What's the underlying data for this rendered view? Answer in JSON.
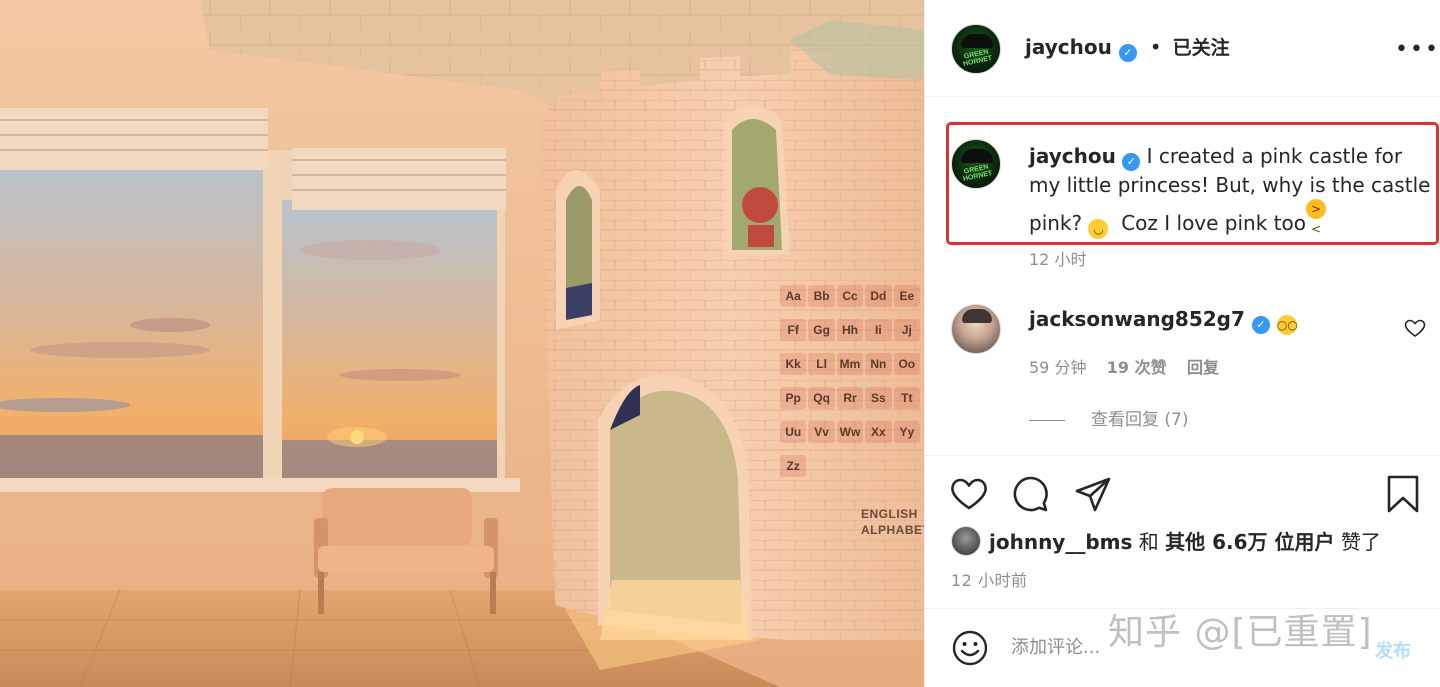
{
  "photo": {
    "alphabet_tiles": [
      "Aa",
      "Bb",
      "Cc",
      "Dd",
      "Ee",
      "Ff",
      "Gg",
      "Hh",
      "Ii",
      "Jj",
      "Kk",
      "Ll",
      "Mm",
      "Nn",
      "Oo",
      "Pp",
      "Qq",
      "Rr",
      "Ss",
      "Tt",
      "Uu",
      "Vv",
      "Ww",
      "Xx",
      "Yy",
      "Zz"
    ],
    "caption": "ENGLISH\nALPHABET"
  },
  "header": {
    "username": "jaychou",
    "separator": "•",
    "follow_status": "已关注",
    "avatar_text": "GREEN HORNET",
    "more_icon": "more-horizontal-icon"
  },
  "caption": {
    "username": "jaychou",
    "text_part1": "I created a pink castle for my little princess! But, why is the castle pink?",
    "text_part2": "Coz I love pink too",
    "emoji_1": "grinning-face",
    "emoji_2": "squinting-tongue-face",
    "time": "12 小时",
    "highlight_color": "#e0322c"
  },
  "comment": {
    "username": "jacksonwang852g7",
    "emoji": "flushed-face",
    "time": "59 分钟",
    "likes": "19 次赞",
    "reply": "回复",
    "view_replies": "查看回复 (7)"
  },
  "actions": {
    "like_icon": "heart-icon",
    "comment_icon": "comment-icon",
    "share_icon": "paper-plane-icon",
    "save_icon": "bookmark-icon"
  },
  "likes": {
    "user": "johnny__bms",
    "connector": "和",
    "others": "其他 6.6万 位用户",
    "suffix": "赞了"
  },
  "timestamp": "12 小时前",
  "comment_bar": {
    "placeholder": "添加评论...",
    "post_label": "发布"
  },
  "watermark": "知乎 @[已重置]",
  "colors": {
    "verified": "#3897f0",
    "secondary_text": "#8e8e8e",
    "post_button": "#b2dffc"
  }
}
